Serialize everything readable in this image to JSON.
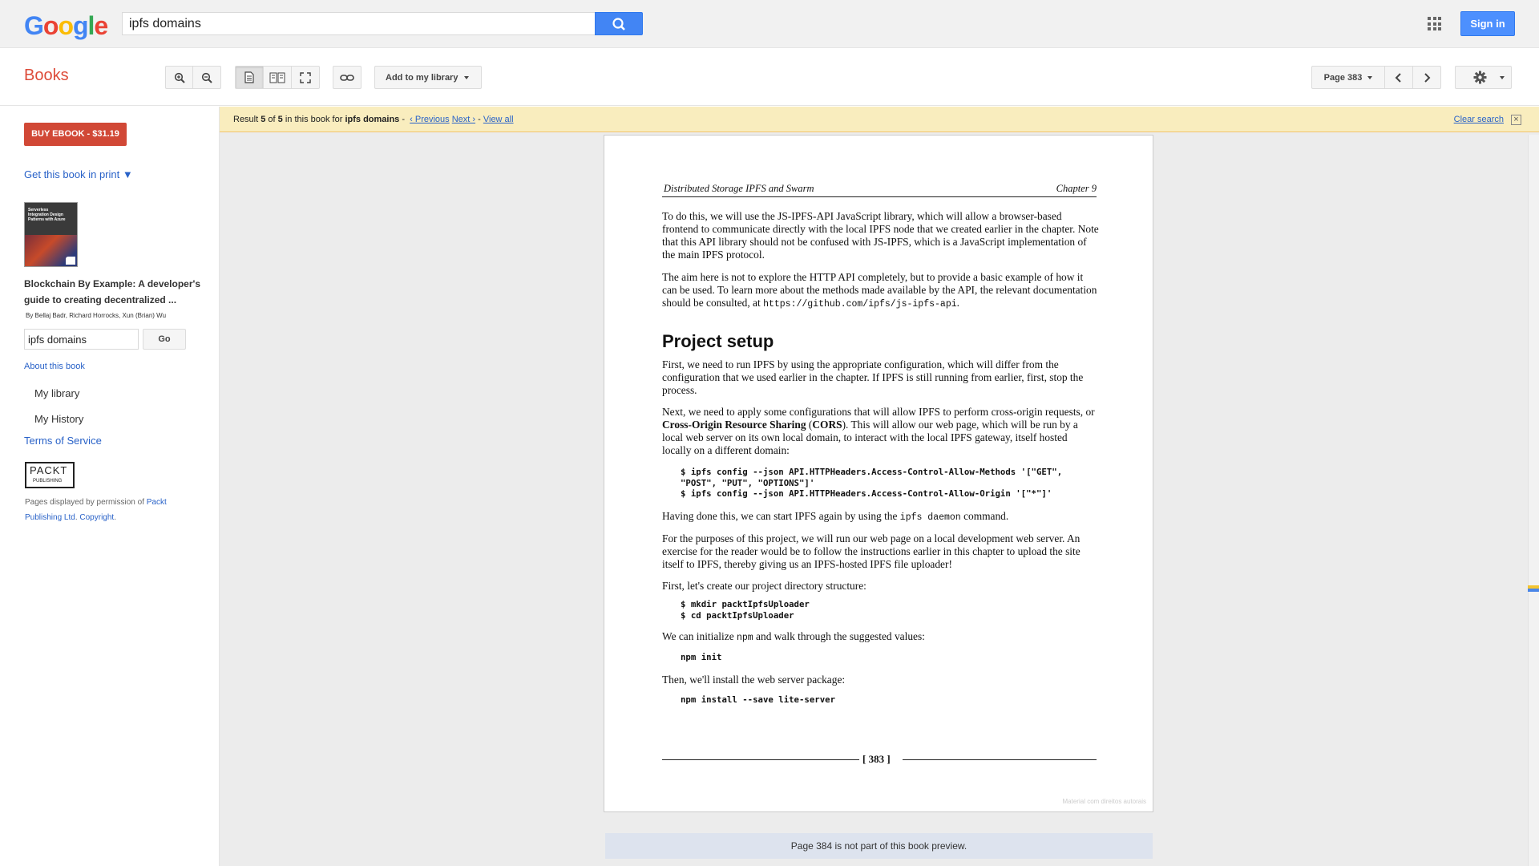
{
  "header": {
    "search_value": "ipfs domains",
    "signin_label": "Sign in"
  },
  "toolbar": {
    "books_label": "Books",
    "add_library_label": "Add to my library",
    "page_select_label": "Page 383"
  },
  "sidebar": {
    "buy_label": "BUY EBOOK - $31.19",
    "get_print_label": "Get this book in print ▼",
    "cover_text": "Serverless Integration Design Patterns with Azure",
    "book_title": "Blockchain By Example: A developer's guide to creating decentralized ...",
    "authors": "By Bellaj Badr, Richard Horrocks, Xun (Brian) Wu",
    "search_value": "ipfs domains",
    "go_label": "Go",
    "about_label": "About this book",
    "my_library": "My library",
    "my_history": "My History",
    "terms": "Terms of Service",
    "publisher_logo_text": "PACKT",
    "publisher_logo_sub": "PUBLISHING",
    "permission_prefix": "Pages displayed by permission of ",
    "permission_link": "Packt Publishing Ltd",
    "permission_sep": ". ",
    "copyright": "Copyright",
    "permission_end": "."
  },
  "notice": {
    "result_word": "Result ",
    "result_num": "5",
    "of_word": " of ",
    "total": "5",
    "in_book": " in this book for ",
    "query": "ipfs domains",
    "sep1": " - ",
    "previous": "‹ Previous",
    "next": "Next ›",
    "sep2": " - ",
    "view_all": "View all",
    "clear_search": "Clear search"
  },
  "page": {
    "header_left": "Distributed Storage IPFS and Swarm",
    "header_right": "Chapter 9",
    "para1": "To do this, we will use the JS-IPFS-API JavaScript library, which will allow a browser-based frontend to communicate directly with the local IPFS node that we created earlier in the chapter. Note that this API library should not be confused with JS-IPFS, which is a JavaScript implementation of the main IPFS protocol.",
    "para2_text": "The aim here is not to explore the HTTP API completely, but to provide a basic example of how it can be used. To learn more about the methods made available by the API, the relevant documentation should be consulted, at ",
    "para2_url": "https://github.com/ipfs/js-ipfs-api",
    "para2_end": ".",
    "heading": "Project setup",
    "para3": "First, we need to run IPFS by using the appropriate configuration, which will differ from the configuration that we used earlier in the chapter. If IPFS is still running from earlier, first, stop the process.",
    "para4_a": "Next, we need to apply some configurations that will allow IPFS to perform cross-origin requests, or ",
    "para4_bold": "Cross-Origin Resource Sharing",
    "para4_b": " (",
    "para4_bold2": "CORS",
    "para4_c": "). This will allow our web page, which will be run by a local web server on its own local domain, to interact with the local IPFS gateway, itself hosted locally on a different domain:",
    "code1": "$ ipfs config --json API.HTTPHeaders.Access-Control-Allow-Methods '[\"GET\",\n\"POST\", \"PUT\", \"OPTIONS\"]'\n$ ipfs config --json API.HTTPHeaders.Access-Control-Allow-Origin '[\"*\"]'",
    "para5_a": "Having done this, we can start IPFS again by using the ",
    "para5_code": "ipfs daemon",
    "para5_b": " command.",
    "para6": "For the purposes of this project, we will run our web page on a local development web server. An exercise for the reader would be to follow the instructions earlier in this chapter to upload the site itself to IPFS, thereby giving us an IPFS-hosted IPFS file uploader!",
    "para7": "First, let's create our project directory structure:",
    "code2": "$ mkdir packtIpfsUploader\n$ cd packtIpfsUploader",
    "para8_a": "We can initialize ",
    "para8_code": "npm",
    "para8_b": " and walk through the suggested values:",
    "code3": "npm init",
    "para9": "Then, we'll install the web server package:",
    "code4": "npm install --save lite-server",
    "page_number": "[ 383 ]",
    "watermark": "Material com direitos autorais"
  },
  "not_part": "Page 384 is not part of this book preview."
}
